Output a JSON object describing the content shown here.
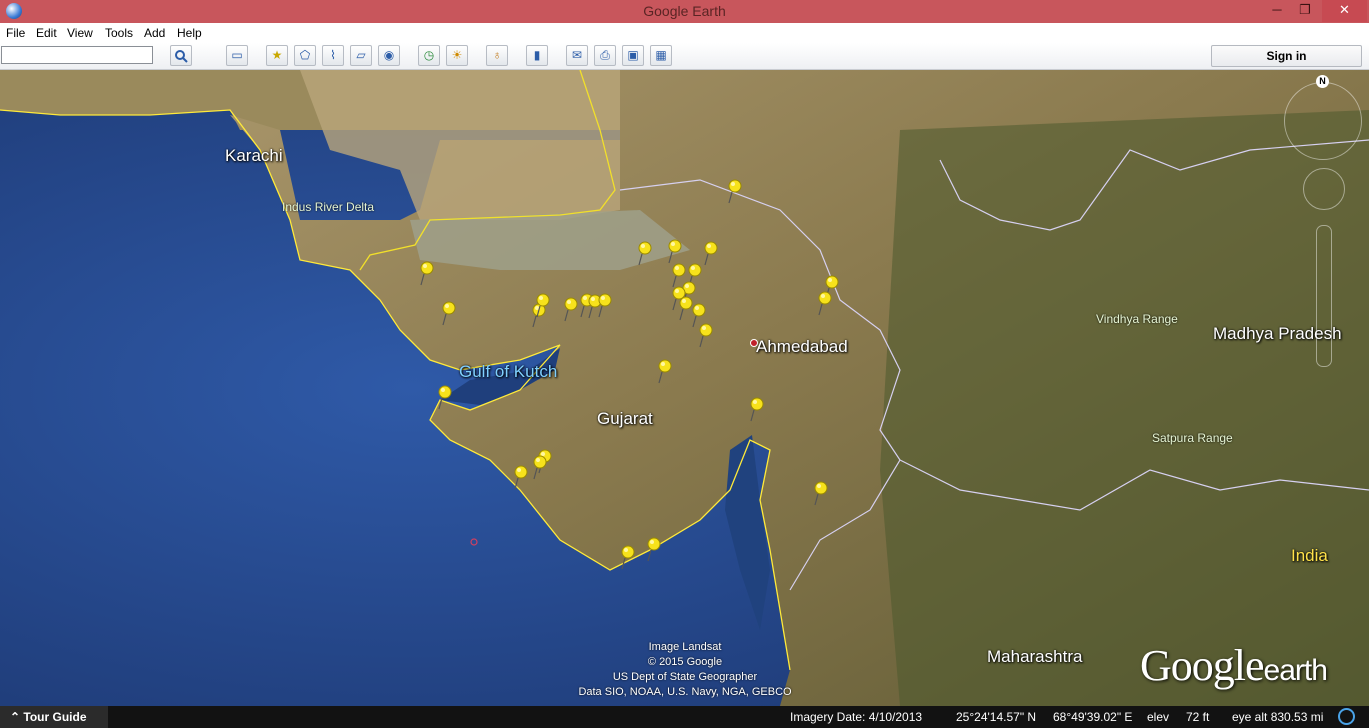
{
  "window": {
    "title": "Google Earth",
    "min": "─",
    "max": "❐",
    "close": "✕"
  },
  "menu": [
    "File",
    "Edit",
    "View",
    "Tools",
    "Add",
    "Help"
  ],
  "toolbar": {
    "search_value": "",
    "search_icon": "magnifier-icon",
    "sign_in": "Sign in",
    "buttons": [
      "sidebar-icon",
      "placemark-icon",
      "polygon-icon",
      "path-icon",
      "image-overlay-icon",
      "record-tour-icon",
      "historical-imagery-icon",
      "sunlight-icon",
      "planets-icon",
      "ruler-icon",
      "email-icon",
      "print-icon",
      "save-image-icon",
      "view-in-maps-icon"
    ]
  },
  "map": {
    "places": [
      {
        "name": "Karachi"
      },
      {
        "name": "Ahmedabad"
      },
      {
        "name": "Gujarat"
      },
      {
        "name": "Gulf of Kutch"
      },
      {
        "name": "Madhya Pradesh"
      },
      {
        "name": "Maharashtra"
      },
      {
        "name": "India"
      }
    ],
    "regions": [
      {
        "name": "Indus River Delta"
      },
      {
        "name": "Vindhya Range"
      },
      {
        "name": "Satpura Range"
      }
    ],
    "compass_n": "N",
    "credits": [
      "Image Landsat",
      "© 2015 Google",
      "US Dept of State Geographer",
      "Data SIO, NOAA, U.S. Navy, NGA, GEBCO"
    ],
    "logo_google": "Google",
    "logo_earth": "earth"
  },
  "status": {
    "tour_guide": "Tour Guide",
    "imagery_date": "Imagery Date: 4/10/2013",
    "lat": "25°24'14.57\" N",
    "lon": "68°49'39.02\" E",
    "elev_label": "elev",
    "elev": "72 ft",
    "eye_alt": "eye alt 830.53 mi"
  }
}
